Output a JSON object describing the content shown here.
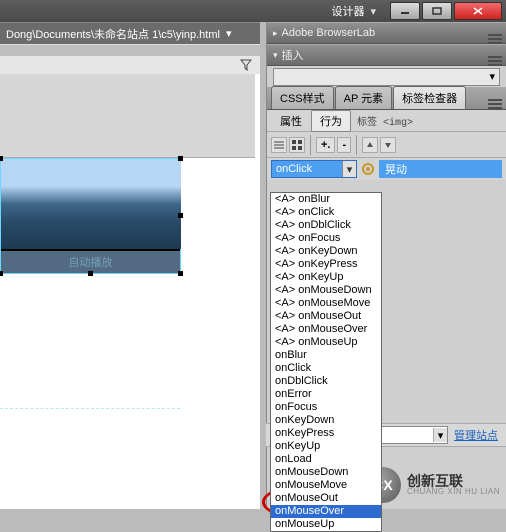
{
  "titlebar": {
    "designer_label": "设计器"
  },
  "pathbar": {
    "path": "Dong\\Documents\\未命名站点 1\\c5\\yinp.html"
  },
  "panels": {
    "browserlab": {
      "title": "Adobe BrowserLab"
    },
    "insert": {
      "title": "插入",
      "dropdown_arrow": "▾"
    },
    "tag_inspector": {
      "tabs": [
        {
          "label": "CSS样式",
          "active": false
        },
        {
          "label": "AP 元素",
          "active": false
        },
        {
          "label": "标签检查器",
          "active": true
        }
      ],
      "sub_tabs": [
        {
          "label": "属性",
          "active": false
        },
        {
          "label": "行为",
          "active": true
        }
      ],
      "tag_label": "标签 <img>",
      "toolbar_plus": "+.",
      "toolbar_minus": "-",
      "event_value": "onClick",
      "effect_label": "晃动",
      "events": [
        "<A> onBlur",
        "<A> onClick",
        "<A> onDblClick",
        "<A> onFocus",
        "<A> onKeyDown",
        "<A> onKeyPress",
        "<A> onKeyUp",
        "<A> onMouseDown",
        "<A> onMouseMove",
        "<A> onMouseOut",
        "<A> onMouseOver",
        "<A> onMouseUp",
        "onBlur",
        "onClick",
        "onDblClick",
        "onError",
        "onFocus",
        "onKeyDown",
        "onKeyPress",
        "onKeyUp",
        "onLoad",
        "onMouseDown",
        "onMouseMove",
        "onMouseOut",
        "onMouseOver",
        "onMouseUp"
      ],
      "selected_event_index": 24
    }
  },
  "manage_site": {
    "link_label": "管理站点"
  },
  "logo": {
    "mark": "CX",
    "cn": "创新互联",
    "en": "CHUANG XIN HU LIAN"
  },
  "image_caption": "自动播放"
}
